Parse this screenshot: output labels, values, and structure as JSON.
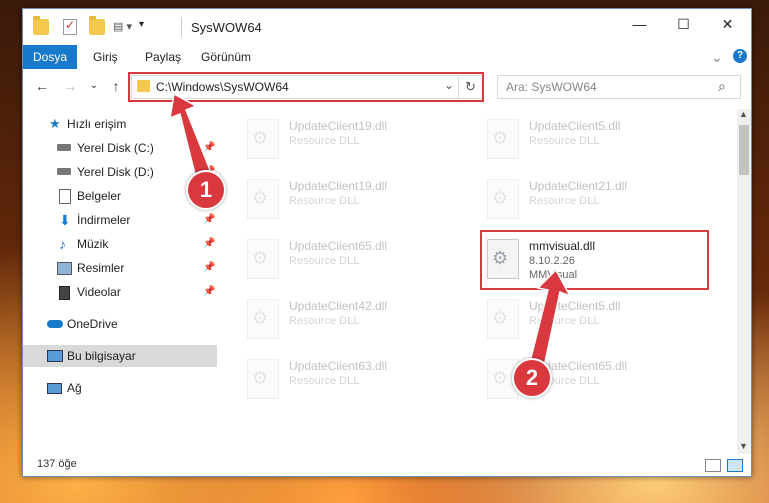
{
  "window": {
    "title": "SysWOW64",
    "minimize": "—",
    "maximize": "☐",
    "close": "✕"
  },
  "ribbon": {
    "tabs": [
      "Dosya",
      "Giriş",
      "Paylaş",
      "Görünüm"
    ],
    "help": "?",
    "expand": "⌄"
  },
  "nav": {
    "back": "←",
    "forward": "→",
    "recent": "⌄",
    "up": "↑",
    "address": "C:\\Windows\\SysWOW64",
    "address_dropdown": "⌄",
    "refresh": "↻",
    "search_placeholder": "Ara: SysWOW64",
    "search_icon": "⌕"
  },
  "sidebar": {
    "items": [
      {
        "label": "Hızlı erişim",
        "icon": "star-icon",
        "pinned": false
      },
      {
        "label": "Yerel Disk (C:)",
        "icon": "drive-icon",
        "pinned": true
      },
      {
        "label": "Yerel Disk (D:)",
        "icon": "drive-icon",
        "pinned": true
      },
      {
        "label": "Belgeler",
        "icon": "documents-icon",
        "pinned": true
      },
      {
        "label": "İndirmeler",
        "icon": "downloads-icon",
        "pinned": true
      },
      {
        "label": "Müzik",
        "icon": "music-icon",
        "pinned": true
      },
      {
        "label": "Resimler",
        "icon": "pictures-icon",
        "pinned": true
      },
      {
        "label": "Videolar",
        "icon": "videos-icon",
        "pinned": true
      },
      {
        "label": "OneDrive",
        "icon": "cloud-icon",
        "pinned": false
      },
      {
        "label": "Bu bilgisayar",
        "icon": "computer-icon",
        "pinned": false,
        "selected": true
      },
      {
        "label": "Ağ",
        "icon": "network-icon",
        "pinned": false
      }
    ],
    "pin_glyph": "📌"
  },
  "files": [
    {
      "name": "UpdateClient19.dll",
      "desc": "Resource DLL"
    },
    {
      "name": "UpdateClient5.dll",
      "desc": "Resource DLL"
    },
    {
      "name": "UpdateClient19.dll",
      "desc": "Resource DLL"
    },
    {
      "name": "UpdateClient21.dll",
      "desc": "Resource DLL"
    },
    {
      "name": "UpdateClient65.dll",
      "desc": "Resource DLL"
    },
    {
      "name": "mmvisual.dll",
      "desc": "8.10.2.26",
      "desc2": "MMVisual",
      "highlighted": true
    },
    {
      "name": "UpdateClient42.dll",
      "desc": "Resource DLL"
    },
    {
      "name": "UpdateClient5.dll",
      "desc": "Resource DLL"
    },
    {
      "name": "UpdateClient63.dll",
      "desc": "Resource DLL"
    },
    {
      "name": "UpdateClient65.dll",
      "desc": "Resource DLL"
    }
  ],
  "status": {
    "count": "137 öğe"
  },
  "annotations": {
    "callout1": "1",
    "callout2": "2",
    "color": "#d9383f"
  },
  "colors": {
    "file_tab": "#1979ca",
    "selected_row": "#d9d9d9"
  }
}
